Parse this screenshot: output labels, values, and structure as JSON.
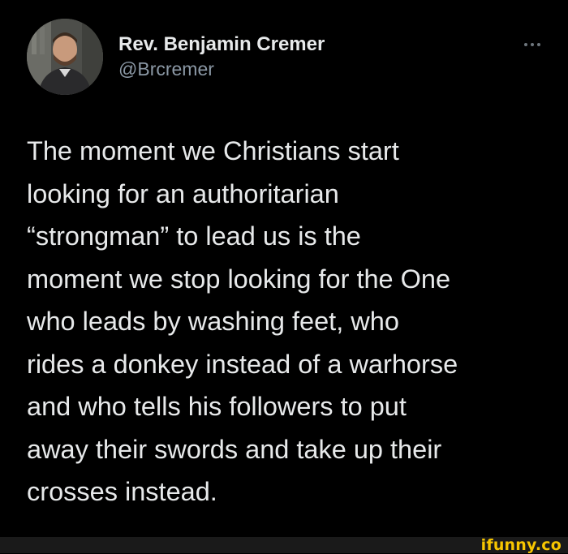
{
  "author": {
    "display_name": "Rev. Benjamin Cremer",
    "handle": "@Brcremer"
  },
  "more_icon": "more-horizontal-icon",
  "tweet": {
    "lines": [
      "The moment we Christians start",
      "looking for an authoritarian",
      "“strongman” to lead us is the",
      "moment we stop looking for the One",
      "who leads by washing feet, who",
      "rides a donkey instead of a warhorse",
      "and who tells his followers to put",
      "away their swords and take up their",
      "crosses instead."
    ]
  },
  "watermark": "ifunny.co",
  "colors": {
    "background": "#000000",
    "text": "#e7e9ea",
    "secondary_text": "#8b98a5",
    "watermark": "#f7c600"
  }
}
